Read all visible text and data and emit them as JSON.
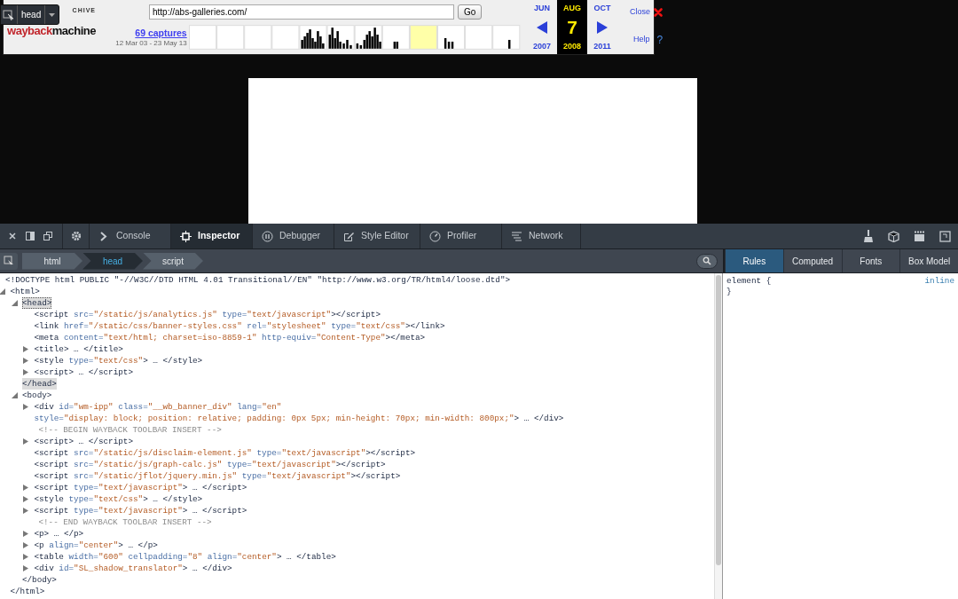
{
  "highlighter": {
    "label": "head"
  },
  "banner": {
    "logo": {
      "top": "CHIVE",
      "left": "wayback",
      "right": "machine"
    },
    "url": "http://abs-galleries.com/",
    "go": "Go",
    "captures": "69 captures",
    "range": "12 Mar 03 - 23 May 13",
    "calendar": [
      {
        "month": "JUN",
        "year": "2007",
        "selected": false
      },
      {
        "month": "AUG",
        "day": "7",
        "year": "2008",
        "selected": true
      },
      {
        "month": "OCT",
        "year": "2011",
        "selected": false
      }
    ],
    "close": "Close",
    "help": "Help",
    "help_mark": "?"
  },
  "devtools": {
    "tabs": [
      {
        "label": "Console",
        "selected": false
      },
      {
        "label": "Inspector",
        "selected": true
      },
      {
        "label": "Debugger",
        "selected": false
      },
      {
        "label": "Style Editor",
        "selected": false
      },
      {
        "label": "Profiler",
        "selected": false
      },
      {
        "label": "Network",
        "selected": false
      }
    ],
    "breadcrumbs": [
      {
        "label": "html",
        "selected": false
      },
      {
        "label": "head",
        "selected": true
      },
      {
        "label": "script",
        "selected": false
      }
    ],
    "side_tabs": [
      {
        "label": "Rules",
        "selected": true
      },
      {
        "label": "Computed",
        "selected": false
      },
      {
        "label": "Fonts",
        "selected": false
      },
      {
        "label": "Box Model",
        "selected": false
      }
    ],
    "markup": [
      {
        "kind": "doctype",
        "text": "<!DOCTYPE html PUBLIC \"-//W3C//DTD HTML 4.01 Transitional//EN\" \"http://www.w3.org/TR/html4/loose.dtd\">"
      },
      {
        "kind": "node",
        "open": "<html",
        "close": ">",
        "end": "</html>",
        "expanded": true,
        "selected": false,
        "children": [
          {
            "kind": "node",
            "open": "<head",
            "close": ">",
            "end": "</head>",
            "expanded": true,
            "selected": true,
            "children": [
              {
                "kind": "leaf",
                "open": "<script",
                "attrs": [
                  {
                    "name": "src=",
                    "value": "\"/static/js/analytics.js\""
                  },
                  {
                    "name": "type=",
                    "value": "\"text/javascript\""
                  }
                ],
                "close": "></script>"
              },
              {
                "kind": "leaf",
                "open": "<link",
                "attrs": [
                  {
                    "name": "href=",
                    "value": "\"/static/css/banner-styles.css\""
                  },
                  {
                    "name": "rel=",
                    "value": "\"stylesheet\""
                  },
                  {
                    "name": "type=",
                    "value": "\"text/css\""
                  }
                ],
                "close": "></link>"
              },
              {
                "kind": "leaf",
                "open": "<meta",
                "attrs": [
                  {
                    "name": "content=",
                    "value": "\"text/html; charset=iso-8859-1\""
                  },
                  {
                    "name": "http-equiv=",
                    "value": "\"Content-Type\""
                  }
                ],
                "close": "></meta>"
              },
              {
                "kind": "node",
                "open": "<title",
                "close": "> … </title>",
                "expanded": false,
                "selected": false
              },
              {
                "kind": "node",
                "open": "<style",
                "attrs": [
                  {
                    "name": "type=",
                    "value": "\"text/css\""
                  }
                ],
                "close": "> … </style>",
                "expanded": false,
                "selected": false
              },
              {
                "kind": "node",
                "open": "<script",
                "close": "> … </script>",
                "expanded": false,
                "selected": false
              }
            ]
          },
          {
            "kind": "node",
            "open": "<body",
            "close": ">",
            "end": "</body>",
            "expanded": true,
            "selected": false,
            "children": [
              {
                "kind": "node",
                "open": "<div",
                "attrs": [
                  {
                    "name": "id=",
                    "value": "\"wm-ipp\""
                  },
                  {
                    "name": "class=",
                    "value": "\"__wb_banner_div\""
                  },
                  {
                    "name": "lang=",
                    "value": "\"en\""
                  },
                  {
                    "name": "style=",
                    "value": "\"display: block; position: relative; padding: 0px 5px; min-height: 70px; min-width: 800px;\""
                  }
                ],
                "close": "> … </div>",
                "expanded": false,
                "selected": false
              },
              {
                "kind": "comment",
                "text": "<!-- BEGIN WAYBACK TOOLBAR INSERT -->"
              },
              {
                "kind": "node",
                "open": "<script",
                "close": "> … </script>",
                "expanded": false,
                "selected": false
              },
              {
                "kind": "leaf",
                "open": "<script",
                "attrs": [
                  {
                    "name": "src=",
                    "value": "\"/static/js/disclaim-element.js\""
                  },
                  {
                    "name": "type=",
                    "value": "\"text/javascript\""
                  }
                ],
                "close": "></script>"
              },
              {
                "kind": "leaf",
                "open": "<script",
                "attrs": [
                  {
                    "name": "src=",
                    "value": "\"/static/js/graph-calc.js\""
                  },
                  {
                    "name": "type=",
                    "value": "\"text/javascript\""
                  }
                ],
                "close": "></script>"
              },
              {
                "kind": "leaf",
                "open": "<script",
                "attrs": [
                  {
                    "name": "src=",
                    "value": "\"/static/jflot/jquery.min.js\""
                  },
                  {
                    "name": "type=",
                    "value": "\"text/javascript\""
                  }
                ],
                "close": "></script>"
              },
              {
                "kind": "node",
                "open": "<script",
                "attrs": [
                  {
                    "name": "type=",
                    "value": "\"text/javascript\""
                  }
                ],
                "close": "> … </script>",
                "expanded": false,
                "selected": false
              },
              {
                "kind": "node",
                "open": "<style",
                "attrs": [
                  {
                    "name": "type=",
                    "value": "\"text/css\""
                  }
                ],
                "close": "> … </style>",
                "expanded": false,
                "selected": false
              },
              {
                "kind": "node",
                "open": "<script",
                "attrs": [
                  {
                    "name": "type=",
                    "value": "\"text/javascript\""
                  }
                ],
                "close": "> … </script>",
                "expanded": false,
                "selected": false
              },
              {
                "kind": "comment",
                "text": "<!-- END WAYBACK TOOLBAR INSERT -->"
              },
              {
                "kind": "node",
                "open": "<p",
                "close": "> … </p>",
                "expanded": false,
                "selected": false
              },
              {
                "kind": "node",
                "open": "<p",
                "attrs": [
                  {
                    "name": "align=",
                    "value": "\"center\""
                  }
                ],
                "close": "> … </p>",
                "expanded": false,
                "selected": false
              },
              {
                "kind": "node",
                "open": "<table",
                "attrs": [
                  {
                    "name": "width=",
                    "value": "\"600\""
                  },
                  {
                    "name": "cellpadding=",
                    "value": "\"8\""
                  },
                  {
                    "name": "align=",
                    "value": "\"center\""
                  }
                ],
                "close": "> … </table>",
                "expanded": false,
                "selected": false
              },
              {
                "kind": "node",
                "open": "<div",
                "attrs": [
                  {
                    "name": "id=",
                    "value": "\"SL_shadow_translator\""
                  }
                ],
                "close": "> … </div>",
                "expanded": false,
                "selected": false
              }
            ]
          }
        ]
      }
    ],
    "rules": {
      "selector": "element {",
      "brace": "}",
      "source": "inline"
    }
  }
}
